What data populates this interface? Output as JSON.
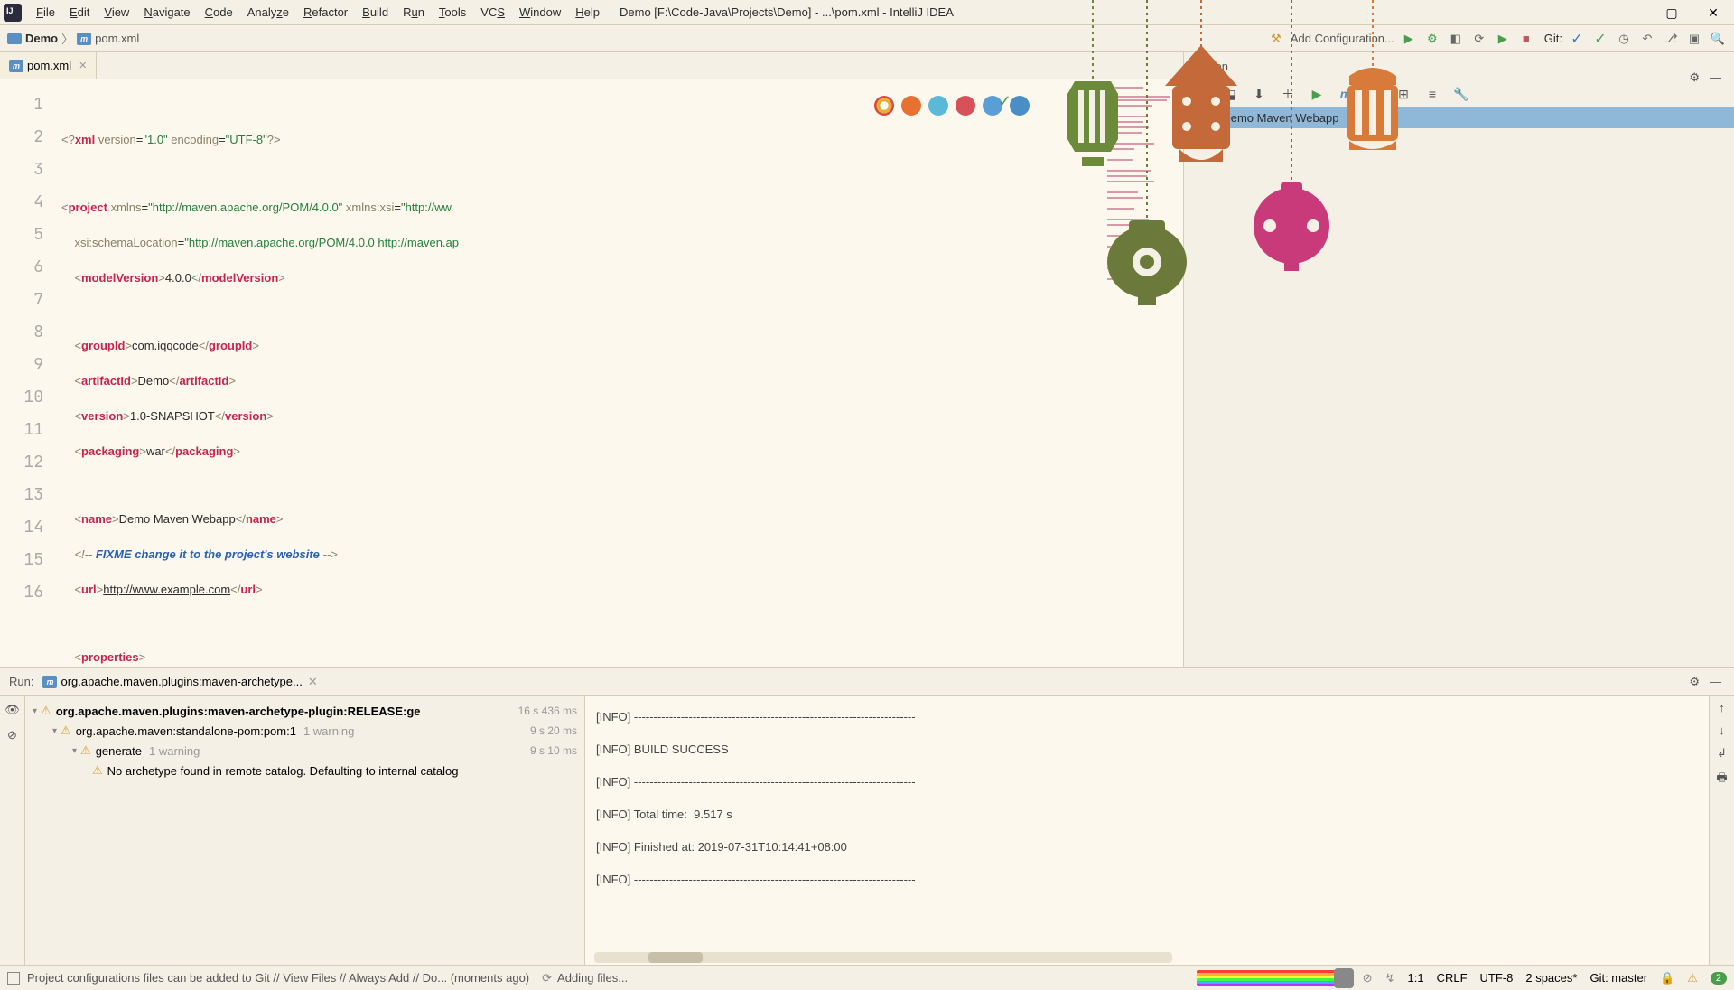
{
  "menu": {
    "items": [
      "File",
      "Edit",
      "View",
      "Navigate",
      "Code",
      "Analyze",
      "Refactor",
      "Build",
      "Run",
      "Tools",
      "VCS",
      "Window",
      "Help"
    ],
    "title": "Demo [F:\\Code-Java\\Projects\\Demo] - ...\\pom.xml - IntelliJ IDEA"
  },
  "breadcrumb": {
    "root": "Demo",
    "file": "pom.xml"
  },
  "navRight": {
    "addConfig": "Add Configuration...",
    "git": "Git:"
  },
  "editor": {
    "tabName": "pom.xml"
  },
  "code": {
    "l1a": "<?",
    "l1b": "xml ",
    "l1c": "version",
    "l1d": "=",
    "l1e": "\"1.0\"",
    "l1f": " encoding",
    "l1g": "=",
    "l1h": "\"UTF-8\"",
    "l1i": "?>",
    "l3a": "<",
    "l3b": "project ",
    "l3c": "xmlns",
    "l3d": "=",
    "l3e": "\"http://maven.apache.org/POM/4.0.0\"",
    "l3f": " xmlns:xsi",
    "l3g": "=",
    "l3h": "\"http://ww",
    "l4a": "    xsi:schemaLocation",
    "l4b": "=",
    "l4c": "\"http://maven.apache.org/POM/4.0.0 http://maven.ap",
    "l5a": "    <",
    "l5b": "modelVersion",
    "l5c": ">",
    "l5d": "4.0.0",
    "l5e": "</",
    "l5f": "modelVersion",
    "l5g": ">",
    "l7a": "    <",
    "l7b": "groupId",
    "l7c": ">",
    "l7d": "com.iqqcode",
    "l7e": "</",
    "l7f": "groupId",
    "l7g": ">",
    "l8a": "    <",
    "l8b": "artifactId",
    "l8c": ">",
    "l8d": "Demo",
    "l8e": "</",
    "l8f": "artifactId",
    "l8g": ">",
    "l9a": "    <",
    "l9b": "version",
    "l9c": ">",
    "l9d": "1.0-SNAPSHOT",
    "l9e": "</",
    "l9f": "version",
    "l9g": ">",
    "l10a": "    <",
    "l10b": "packaging",
    "l10c": ">",
    "l10d": "war",
    "l10e": "</",
    "l10f": "packaging",
    "l10g": ">",
    "l12a": "    <",
    "l12b": "name",
    "l12c": ">",
    "l12d": "Demo Maven Webapp",
    "l12e": "</",
    "l12f": "name",
    "l12g": ">",
    "l13a": "    <!-- ",
    "l13b": "FIXME change it to the project's website",
    "l13c": " -->",
    "l14a": "    <",
    "l14b": "url",
    "l14c": ">",
    "l14d": "http://www.example.com",
    "l14e": "</",
    "l14f": "url",
    "l14g": ">",
    "l16a": "    <",
    "l16b": "properties",
    "l16c": ">"
  },
  "maven": {
    "title": "Maven",
    "selected": "Demo Maven Webapp"
  },
  "run": {
    "label": "Run:",
    "config": "org.apache.maven.plugins:maven-archetype...",
    "tree": [
      {
        "text": "org.apache.maven.plugins:maven-archetype-plugin:RELEASE:ge",
        "time": "16 s 436 ms",
        "bold": true,
        "indent": 0
      },
      {
        "text": "org.apache.maven:standalone-pom:pom:1",
        "sub": "1 warning",
        "time": "9 s 20 ms",
        "indent": 1
      },
      {
        "text": "generate",
        "sub": "1 warning",
        "time": "9 s 10 ms",
        "indent": 2
      },
      {
        "text": "No archetype found in remote catalog. Defaulting to internal catalog",
        "indent": 3,
        "notime": true
      }
    ],
    "output": [
      "[INFO] ------------------------------------------------------------------------",
      "[INFO] BUILD SUCCESS",
      "[INFO] ------------------------------------------------------------------------",
      "[INFO] Total time:  9.517 s",
      "[INFO] Finished at: 2019-07-31T10:14:41+08:00",
      "[INFO] ------------------------------------------------------------------------"
    ]
  },
  "status": {
    "msg": "Project configurations files can be added to Git // View Files // Always Add // Do... (moments ago)",
    "loading": "Adding files...",
    "pos": "1:1",
    "enc": "CRLF",
    "charset": "UTF-8",
    "indent": "2 spaces*",
    "git": "Git: master",
    "badge": "2"
  }
}
